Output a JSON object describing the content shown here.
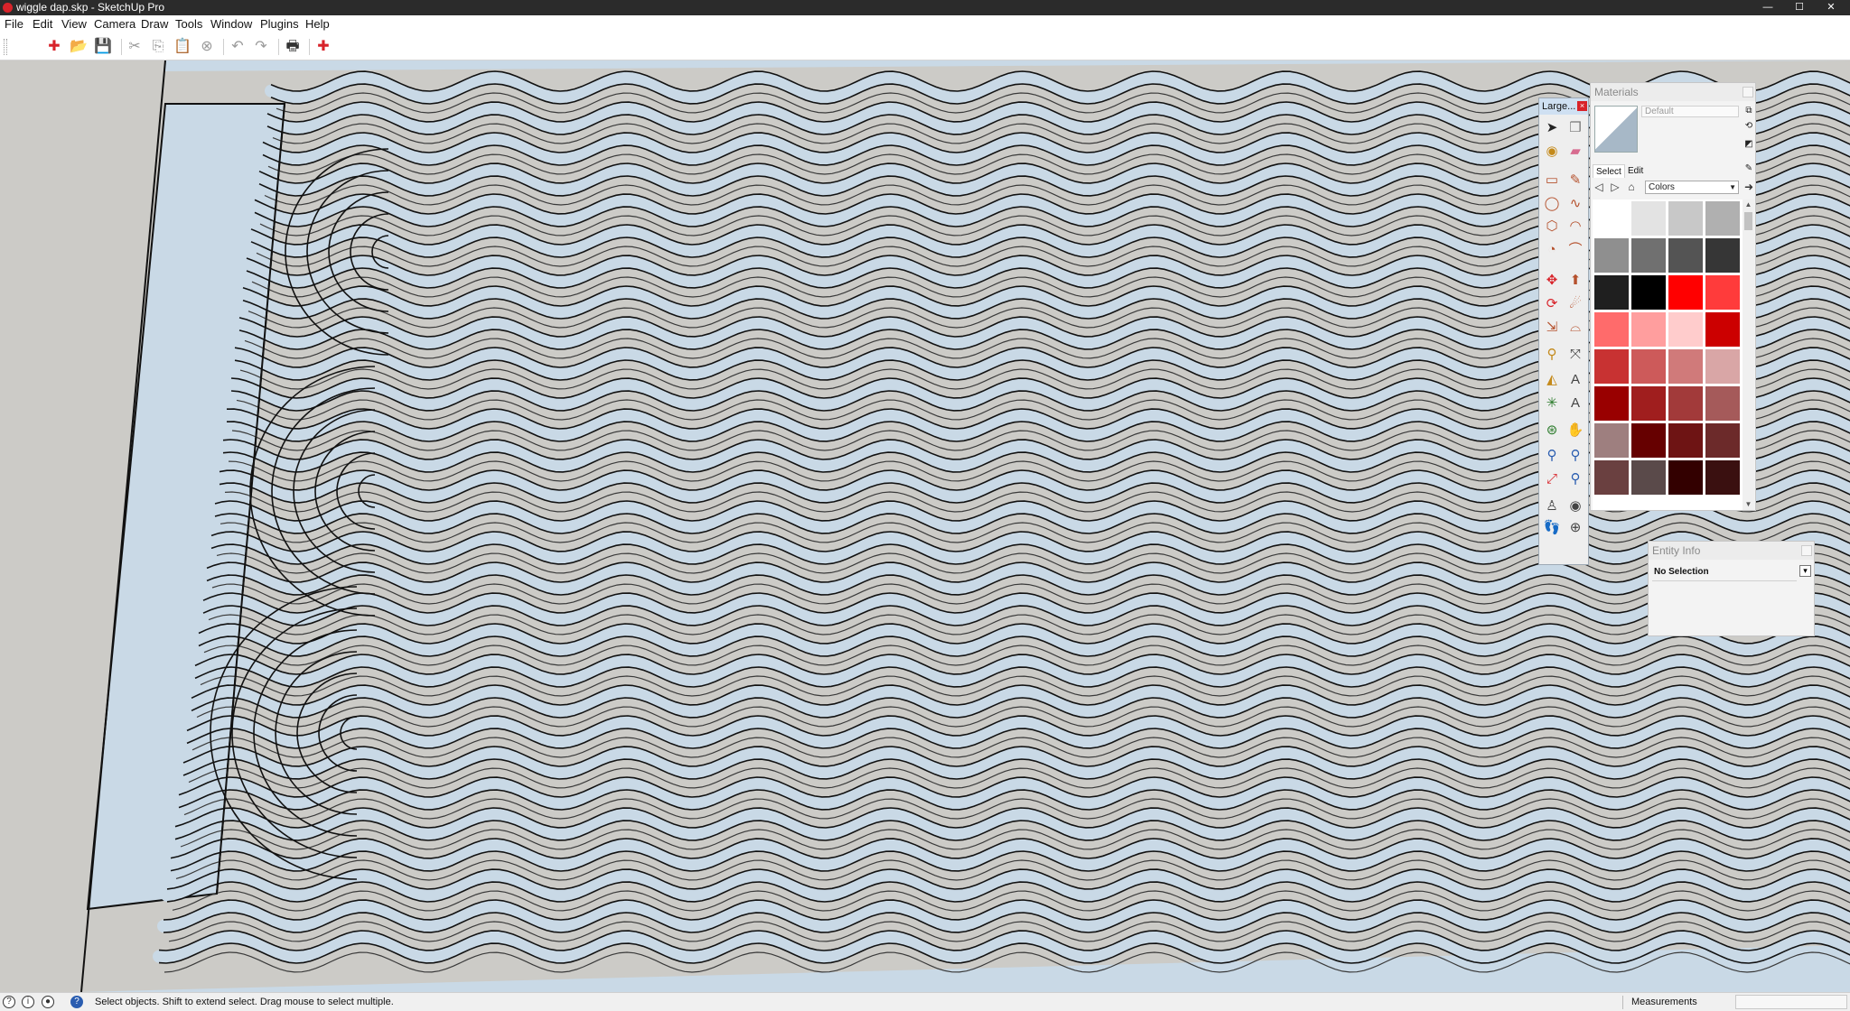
{
  "window": {
    "title": "wiggle dap.skp - SketchUp Pro",
    "minimize_glyph": "—",
    "maximize_glyph": "☐",
    "close_glyph": "✕"
  },
  "menu": {
    "items": [
      "File",
      "Edit",
      "View",
      "Camera",
      "Draw",
      "Tools",
      "Window",
      "Plugins",
      "Help"
    ]
  },
  "toolbar": {
    "buttons": [
      {
        "name": "new-model-icon",
        "glyph": "✚",
        "color": "#d8232a"
      },
      {
        "name": "open-folder-icon",
        "glyph": "📂",
        "color": "#a07a2c"
      },
      {
        "name": "save-icon",
        "glyph": "💾",
        "color": "#2a5db0"
      },
      {
        "name": "cut-icon",
        "glyph": "✂",
        "color": "#999999"
      },
      {
        "name": "copy-icon",
        "glyph": "⎘",
        "color": "#999999"
      },
      {
        "name": "paste-icon",
        "glyph": "📋",
        "color": "#999999"
      },
      {
        "name": "erase-icon",
        "glyph": "⊗",
        "color": "#999999"
      },
      {
        "name": "undo-icon",
        "glyph": "↶",
        "color": "#999999"
      },
      {
        "name": "redo-icon",
        "glyph": "↷",
        "color": "#999999"
      },
      {
        "name": "print-icon",
        "glyph": "🖶",
        "color": "#333333"
      },
      {
        "name": "model-info-icon",
        "glyph": "✚",
        "color": "#d8232a"
      }
    ]
  },
  "large_toolset": {
    "title": "Large...",
    "close_glyph": "×",
    "tools": [
      {
        "name": "select-tool-icon",
        "glyph": "➤",
        "color": "#222222"
      },
      {
        "name": "make-component-icon",
        "glyph": "❒",
        "color": "#777777"
      },
      {
        "name": "paint-bucket-icon",
        "glyph": "◉",
        "color": "#c48a1b"
      },
      {
        "name": "eraser-icon",
        "glyph": "▰",
        "color": "#d76b8f"
      },
      {
        "name": "rectangle-tool-icon",
        "glyph": "▭",
        "color": "#b5512d"
      },
      {
        "name": "line-tool-icon",
        "glyph": "✎",
        "color": "#b5512d"
      },
      {
        "name": "circle-tool-icon",
        "glyph": "◯",
        "color": "#b5512d"
      },
      {
        "name": "freehand-tool-icon",
        "glyph": "∿",
        "color": "#b5512d"
      },
      {
        "name": "polygon-tool-icon",
        "glyph": "⬡",
        "color": "#b5512d"
      },
      {
        "name": "arc-tool-icon",
        "glyph": "◠",
        "color": "#b5512d"
      },
      {
        "name": "pie-tool-icon",
        "glyph": "◔",
        "color": "#b5512d"
      },
      {
        "name": "two-point-arc-icon",
        "glyph": "⌒",
        "color": "#b5512d"
      },
      {
        "name": "move-tool-icon",
        "glyph": "✥",
        "color": "#d8232a"
      },
      {
        "name": "push-pull-tool-icon",
        "glyph": "⬆",
        "color": "#b5512d"
      },
      {
        "name": "rotate-tool-icon",
        "glyph": "⟳",
        "color": "#d8232a"
      },
      {
        "name": "follow-me-tool-icon",
        "glyph": "☄",
        "color": "#b5512d"
      },
      {
        "name": "scale-tool-icon",
        "glyph": "⇲",
        "color": "#b5512d"
      },
      {
        "name": "offset-tool-icon",
        "glyph": "⌓",
        "color": "#b5512d"
      },
      {
        "name": "tape-measure-icon",
        "glyph": "⚲",
        "color": "#c48a1b"
      },
      {
        "name": "dimension-tool-icon",
        "glyph": "⤧",
        "color": "#444444"
      },
      {
        "name": "protractor-tool-icon",
        "glyph": "◭",
        "color": "#c48a1b"
      },
      {
        "name": "text-tool-icon",
        "glyph": "A",
        "color": "#444444"
      },
      {
        "name": "axes-tool-icon",
        "glyph": "✳",
        "color": "#2a7a2a"
      },
      {
        "name": "3d-text-tool-icon",
        "glyph": "A",
        "color": "#444444"
      },
      {
        "name": "orbit-tool-icon",
        "glyph": "⊛",
        "color": "#2a7a2a"
      },
      {
        "name": "pan-tool-icon",
        "glyph": "✋",
        "color": "#444444"
      },
      {
        "name": "zoom-tool-icon",
        "glyph": "⚲",
        "color": "#2a5db0"
      },
      {
        "name": "zoom-window-icon",
        "glyph": "⚲",
        "color": "#2a5db0"
      },
      {
        "name": "zoom-extents-icon",
        "glyph": "⤢",
        "color": "#d8232a"
      },
      {
        "name": "previous-view-icon",
        "glyph": "⚲",
        "color": "#2a5db0"
      },
      {
        "name": "position-camera-icon",
        "glyph": "♙",
        "color": "#444444"
      },
      {
        "name": "look-around-icon",
        "glyph": "◉",
        "color": "#444444"
      },
      {
        "name": "walk-tool-icon",
        "glyph": "👣",
        "color": "#444444"
      },
      {
        "name": "section-plane-icon",
        "glyph": "⊕",
        "color": "#444444"
      }
    ]
  },
  "materials": {
    "title": "Materials",
    "material_name": "Default",
    "tabs": [
      "Select",
      "Edit"
    ],
    "library": "Colors",
    "swatches": [
      "#ffffff",
      "#e3e3e3",
      "#c8c8c8",
      "#b0b0b0",
      "#8f8f8f",
      "#707070",
      "#545454",
      "#363636",
      "#1f1f1f",
      "#000000",
      "#ff0000",
      "#ff3b3b",
      "#ff6b6b",
      "#ff9e9e",
      "#ffcccc",
      "#cc0000",
      "#c83232",
      "#cd5a5a",
      "#d07a7a",
      "#d9a6a6",
      "#990000",
      "#a01e1e",
      "#a23a3a",
      "#a55a5a",
      "#9e7f7f",
      "#660000",
      "#6e1414",
      "#6c2a2a",
      "#6a4040",
      "#5a4a4a",
      "#330000",
      "#3a1010"
    ]
  },
  "entity_info": {
    "title": "Entity Info",
    "selection": "No Selection"
  },
  "statusbar": {
    "hint": "Select objects. Shift to extend select. Drag mouse to select multiple.",
    "measurements_label": "Measurements",
    "measurements_value": ""
  },
  "scene": {
    "sky_color": "#c9d9e6",
    "ground_color": "#cccbc7",
    "edge_color": "#111111",
    "stroke_colors": [
      "#111111",
      "#3a3a3a"
    ]
  }
}
